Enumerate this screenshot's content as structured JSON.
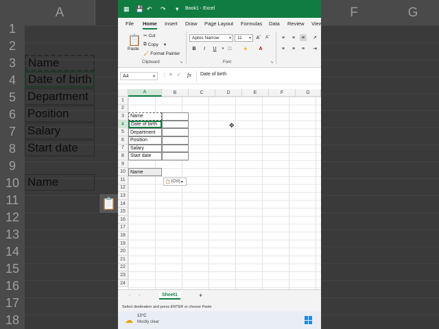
{
  "background": {
    "col_headers": [
      "A",
      "F",
      "G"
    ],
    "row_numbers": [
      "1",
      "2",
      "3",
      "4",
      "5",
      "6",
      "7",
      "8",
      "9",
      "10",
      "11",
      "12",
      "13",
      "14",
      "15",
      "16",
      "17",
      "18"
    ],
    "cells": [
      "Name",
      "Date of birth",
      "Department",
      "Position",
      "Salary",
      "Start date",
      "Name"
    ]
  },
  "window": {
    "title": "Book1 - Excel",
    "menu_tabs": [
      "File",
      "Home",
      "Insert",
      "Draw",
      "Page Layout",
      "Formulas",
      "Data",
      "Review",
      "View"
    ],
    "active_tab": "Home"
  },
  "ribbon": {
    "paste_label": "Paste",
    "cut_label": "Cut",
    "copy_label": "Copy",
    "format_painter_label": "Format Painter",
    "clipboard_group": "Clipboard",
    "font_name": "Aptos Narrow",
    "font_size": "11",
    "font_group": "Font"
  },
  "formula_bar": {
    "name_box": "A4",
    "fx": "fx",
    "formula": "Date of birth"
  },
  "sheet": {
    "columns": [
      "A",
      "B",
      "C",
      "D",
      "E",
      "F",
      "G"
    ],
    "rows": [
      "1",
      "2",
      "3",
      "4",
      "5",
      "6",
      "7",
      "8",
      "9",
      "10",
      "11",
      "12",
      "13",
      "14",
      "15",
      "16",
      "17",
      "18",
      "19",
      "20",
      "21",
      "22",
      "23",
      "24"
    ],
    "cells": [
      "Name",
      "Date of birth",
      "Department",
      "Position",
      "Salary",
      "Start date"
    ],
    "pasted": "Name",
    "ctrl_chip": "(Ctrl)"
  },
  "sheet_tabs": {
    "active": "Sheet1",
    "add": "+"
  },
  "status_text": "Select destination and press ENTER or choose Paste",
  "taskbar": {
    "temp": "13°C",
    "weather": "Mostly clear"
  },
  "colors": {
    "excel_green": "#107c41",
    "title_bar": "#107c41"
  }
}
